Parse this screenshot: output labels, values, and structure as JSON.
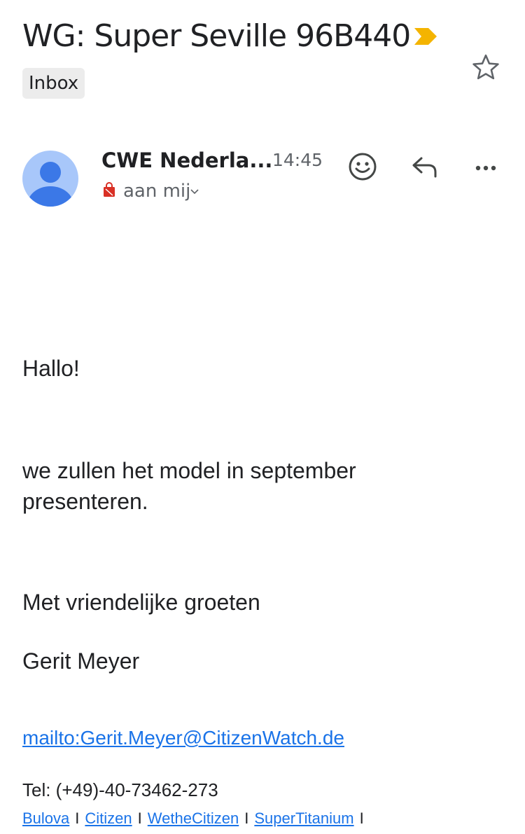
{
  "header": {
    "subject": "WG: Super Seville 96B440",
    "label": "Inbox",
    "importance_color": "#F4B400",
    "star_icon": "star-outline-icon"
  },
  "message": {
    "sender": "CWE Nederla...",
    "time": "14:45",
    "recipient": "aan mij",
    "avatar_color": "#A8C7FA",
    "avatar_figure_color": "#3B78E7",
    "actions": {
      "emoji_icon": "smiley-icon",
      "reply_icon": "reply-icon",
      "more_icon": "more-horizontal-icon"
    }
  },
  "body": {
    "greeting": "Hallo!",
    "paragraph": "we zullen het model in september presenteren.",
    "closing": "Met vriendelijke groeten",
    "signature": "Gerit Meyer",
    "mail_link": "mailto:Gerit.Meyer@CitizenWatch.de",
    "tel": "Tel: (+49)-40-73462-273",
    "footer_links": [
      "Bulova",
      "Citizen",
      "WetheCitizen",
      "SuperTitanium"
    ],
    "footer_separator": "I"
  }
}
